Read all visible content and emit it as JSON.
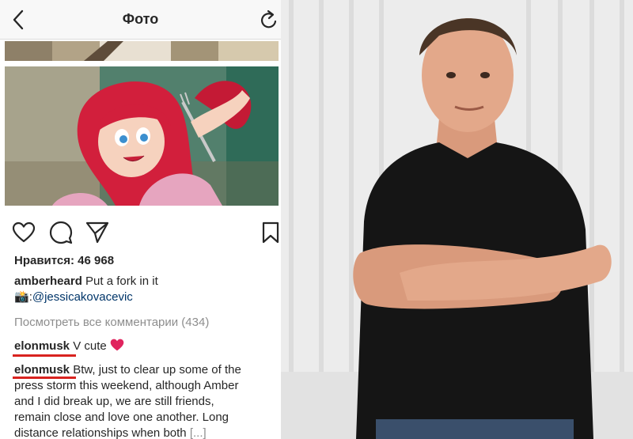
{
  "header": {
    "title": "Фото",
    "back_icon": "chevron-left-icon",
    "reload_icon": "reload-icon"
  },
  "actions": {
    "like_icon": "heart-icon",
    "comment_icon": "comment-icon",
    "share_icon": "send-icon",
    "save_icon": "bookmark-icon"
  },
  "post": {
    "likes": "Нравится: 46 968",
    "author": "amberheard",
    "caption": " Put a fork in it",
    "credit_prefix": ":",
    "credit_mention": "@jessicakovacevic",
    "view_all_comments": "Посмотреть все комментарии (434)"
  },
  "comments": [
    {
      "user": "elonmusk",
      "text": " V cute "
    },
    {
      "user": "elonmusk",
      "line1": " Btw, just to clear up some of the",
      "line2": "press storm this weekend, although Amber",
      "line3": "and I did break up, we are still friends,",
      "line4": "remain close and love one another. Long",
      "line5": "distance relationships when both ",
      "more": "[...]"
    }
  ],
  "colors": {
    "accent_underline": "#d8231f",
    "heart": "#e0245e",
    "mention": "#003569",
    "muted": "#8e8e8e"
  }
}
